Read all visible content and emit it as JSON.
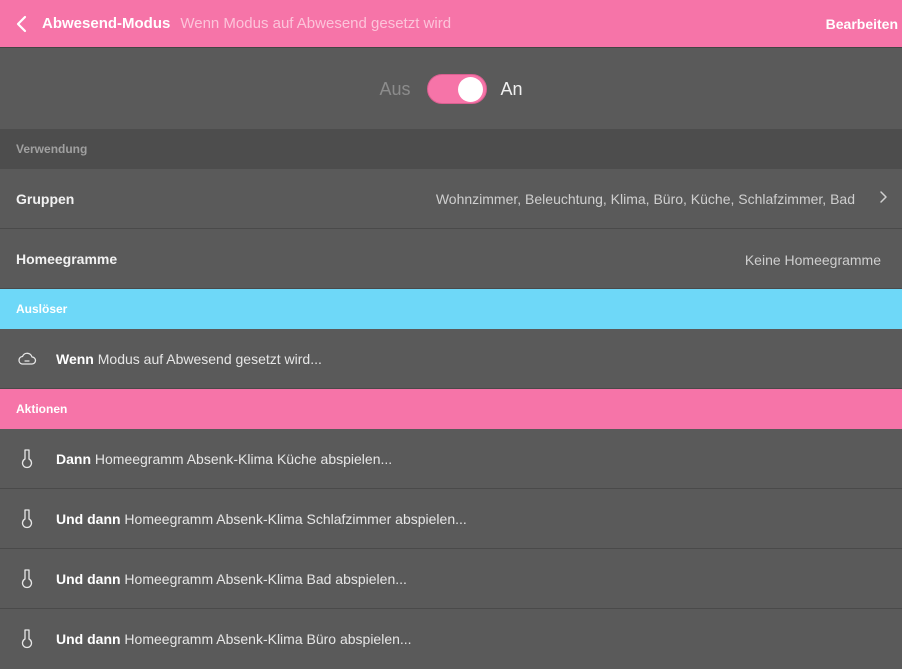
{
  "header": {
    "title": "Abwesend-Modus",
    "subtitle": "Wenn Modus auf Abwesend gesetzt wird",
    "edit_label": "Bearbeiten"
  },
  "toggle": {
    "off_label": "Aus",
    "on_label": "An",
    "state": "on"
  },
  "usage": {
    "section_label": "Verwendung",
    "groups": {
      "label": "Gruppen",
      "value": "Wohnzimmer, Beleuchtung, Klima, Büro, Küche, Schlafzimmer, Bad"
    },
    "homeegrams": {
      "label": "Homeegramme",
      "value": "Keine Homeegramme"
    }
  },
  "trigger": {
    "section_label": "Auslöser",
    "items": [
      {
        "prefix": "Wenn",
        "text": " Modus auf Abwesend gesetzt wird...",
        "icon": "cloud-icon"
      }
    ]
  },
  "actions": {
    "section_label": "Aktionen",
    "items": [
      {
        "prefix": "Dann",
        "text": " Homeegramm Absenk-Klima Küche abspielen...",
        "icon": "homeegram-icon"
      },
      {
        "prefix": "Und dann",
        "text": " Homeegramm Absenk-Klima Schlafzimmer abspielen...",
        "icon": "homeegram-icon"
      },
      {
        "prefix": "Und dann",
        "text": " Homeegramm Absenk-Klima Bad abspielen...",
        "icon": "homeegram-icon"
      },
      {
        "prefix": "Und dann",
        "text": " Homeegramm Absenk-Klima Büro abspielen...",
        "icon": "homeegram-icon"
      }
    ]
  },
  "colors": {
    "accent_pink": "#f674a8",
    "trigger_blue": "#6ed8f8",
    "background": "#5a5a5a"
  }
}
